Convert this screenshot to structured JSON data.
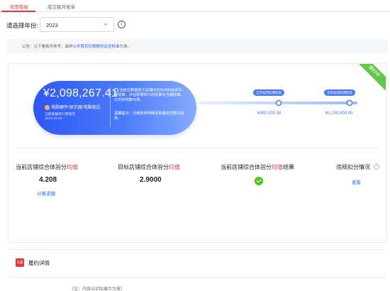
{
  "tabs": [
    {
      "label": "年度看板",
      "active": true
    },
    {
      "label": "成交额月账单",
      "active": false
    }
  ],
  "year_filter": {
    "label": "请选择年份:",
    "selected": "2023"
  },
  "notice": {
    "prefix": "公告：以下看板供参考，最终以",
    "link": "年度扣扣费额的返还标准",
    "suffix": "为准。"
  },
  "status_ribbon": "履约中",
  "summary": {
    "amount": "¥2,098,267.41",
    "badge": "电脑硬件/显示器/电脑周边",
    "updated_line1": "当前数据统计更新至",
    "updated_line2": "2023-10-24",
    "note": "该成交数据用于店铺内货年中的技术年度结算，并在数据统计的结算为当期结算，以实际结算为准。",
    "tip": "温馨提示：月度账单明细请查看成交额月账单。"
  },
  "milestones": [
    {
      "label": "全年返回扣费阶段",
      "amount": "¥360,000.00"
    },
    {
      "label": "全年返回扣费阶段",
      "amount": "¥1,200,000.00"
    }
  ],
  "metrics": [
    {
      "title_prefix": "当前店铺综合体验分",
      "title_highlight": "均值",
      "title_suffix": "",
      "value": "4.208",
      "link": "计算逻辑"
    },
    {
      "title_prefix": "目标店铺综合体验分",
      "title_highlight": "均值",
      "title_suffix": "",
      "value": "2.9000"
    },
    {
      "title_prefix": "当前店铺综合体验分",
      "title_highlight": "均值",
      "title_suffix": "结果",
      "result_icon": "check-icon"
    },
    {
      "title_prefix": "违规扣分情况",
      "title_highlight": "",
      "title_suffix": "",
      "link": "查看"
    }
  ],
  "performance": {
    "logo_text": "天猫",
    "title": "履约详情"
  },
  "bottom_partial": "（注：内容以实际展示为准）",
  "colors": {
    "accent_red": "#e53935",
    "link_blue": "#2b66ff",
    "card_blue": "#3a66f7",
    "success_green": "#52c41a",
    "ribbon_green": "#63c74a"
  }
}
